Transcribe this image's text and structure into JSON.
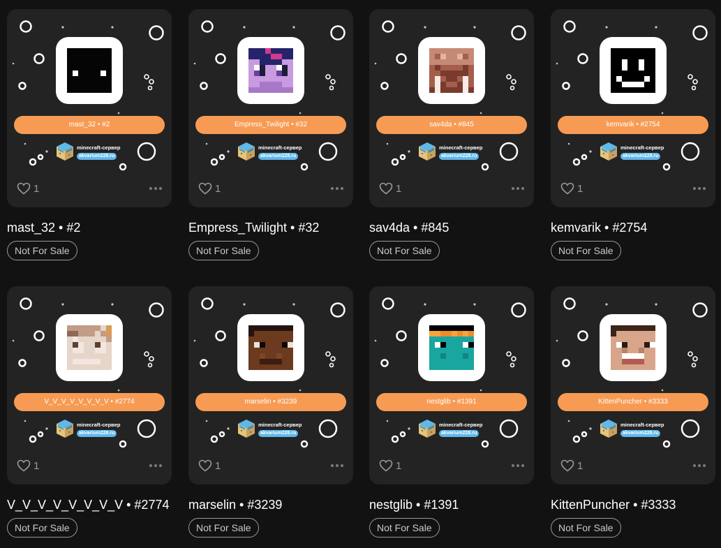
{
  "nfts": [
    {
      "name": "mast_32",
      "number": "#2",
      "pill_label": "mast_32 • #2",
      "title": "mast_32 • #2",
      "likes": "1",
      "sale_status": "Not For Sale",
      "skin": "black-face-skin"
    },
    {
      "name": "Empress_Twilight",
      "number": "#32",
      "pill_label": "Empress_Twilight • #32",
      "title": "Empress_Twilight • #32",
      "likes": "1",
      "sale_status": "Not For Sale",
      "skin": "purple-pony-skin"
    },
    {
      "name": "sav4da",
      "number": "#845",
      "pill_label": "sav4da • #845",
      "title": "sav4da • #845",
      "likes": "1",
      "sale_status": "Not For Sale",
      "skin": "walrus-skin"
    },
    {
      "name": "kemvarik",
      "number": "#2754",
      "pill_label": "kemvarik • #2754",
      "title": "kemvarik • #2754",
      "likes": "1",
      "sale_status": "Not For Sale",
      "skin": "smiley-skin"
    },
    {
      "name": "V_V_V_V_V_V_V_V",
      "number": "#2774",
      "pill_label": "V_V_V_V_V_V_V_V • #2774",
      "title": "V_V_V_V_V_V_V_V • #2774",
      "likes": "1",
      "sale_status": "Not For Sale",
      "skin": "pale-skin"
    },
    {
      "name": "marselin",
      "number": "#3239",
      "pill_label": "marselin • #3239",
      "title": "marselin • #3239",
      "likes": "1",
      "sale_status": "Not For Sale",
      "skin": "dark-face-skin"
    },
    {
      "name": "nestglib",
      "number": "#1391",
      "pill_label": "nestglib • #1391",
      "title": "nestglib • #1391",
      "likes": "1",
      "sale_status": "Not For Sale",
      "skin": "platypus-skin"
    },
    {
      "name": "KittenPuncher",
      "number": "#3333",
      "pill_label": "KittenPuncher • #3333",
      "title": "KittenPuncher • #3333",
      "likes": "1",
      "sale_status": "Not For Sale",
      "skin": "grin-face-skin"
    }
  ],
  "server": {
    "name": "minecraft-сервер",
    "url": "akvarium228.ru"
  },
  "colors": {
    "background": "#121212",
    "card": "#232323",
    "pill": "#f79b54",
    "server_badge": "#5fb8ea",
    "badge_border": "#9a9a9a"
  }
}
